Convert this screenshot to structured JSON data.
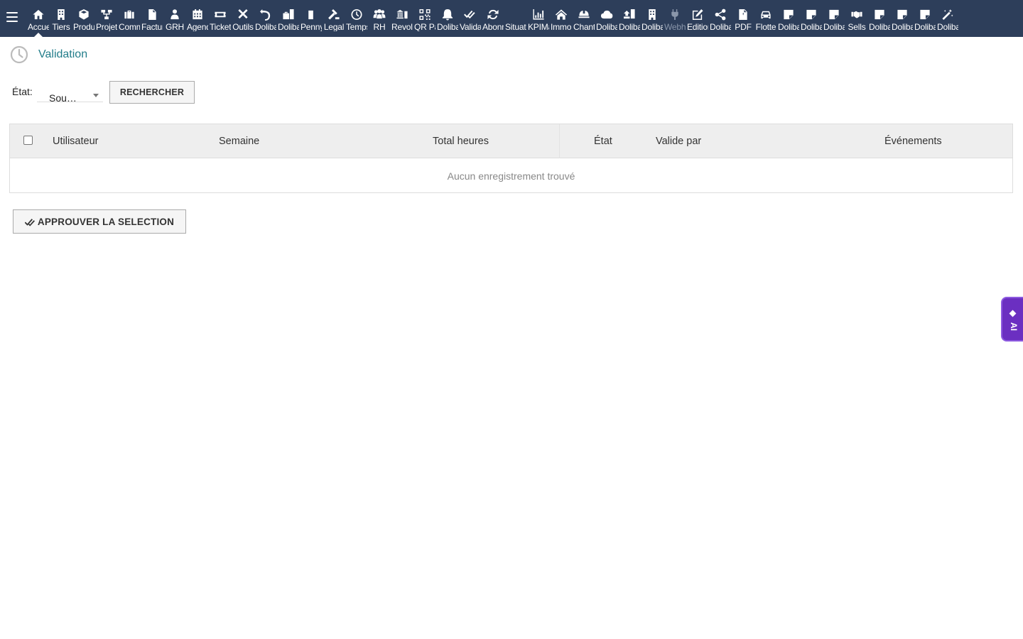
{
  "nav": {
    "items": [
      {
        "label": "Accueil",
        "icon": "home-icon",
        "active": true
      },
      {
        "label": "Tiers",
        "icon": "building-icon"
      },
      {
        "label": "Produits",
        "icon": "cube-icon"
      },
      {
        "label": "Projets",
        "icon": "project-icon"
      },
      {
        "label": "Commerce",
        "icon": "briefcase-icon"
      },
      {
        "label": "Facturation",
        "icon": "invoice-icon"
      },
      {
        "label": "GRH",
        "icon": "users-icon"
      },
      {
        "label": "Agenda",
        "icon": "calendar-icon"
      },
      {
        "label": "Tickets",
        "icon": "ticket-icon"
      },
      {
        "label": "Outils",
        "icon": "tools-icon"
      },
      {
        "label": "Dolibarr",
        "icon": "undo-icon"
      },
      {
        "label": "Dolibarr",
        "icon": "suitcase-icon"
      },
      {
        "label": "Penny",
        "icon": "note-icon"
      },
      {
        "label": "Legal",
        "icon": "gavel-icon"
      },
      {
        "label": "Temps",
        "icon": "clock-icon"
      },
      {
        "label": "RH",
        "icon": "group-icon"
      },
      {
        "label": "Revolut",
        "icon": "bank-icon"
      },
      {
        "label": "QR Pay",
        "icon": "qrcode-icon"
      },
      {
        "label": "Dolibarr",
        "icon": "bell-icon"
      },
      {
        "label": "Validation",
        "icon": "check-double-icon"
      },
      {
        "label": "Abonnements",
        "icon": "sync-icon"
      },
      {
        "label": "Situation",
        "icon": "blank-icon"
      },
      {
        "label": "KPIMax",
        "icon": "chart-bar-icon"
      },
      {
        "label": "Immobilier",
        "icon": "house-icon"
      },
      {
        "label": "Chantier",
        "icon": "helmet-icon"
      },
      {
        "label": "Dolibarr",
        "icon": "cloud-icon"
      },
      {
        "label": "Dolibarr",
        "icon": "upload-icon"
      },
      {
        "label": "Dolibarr",
        "icon": "building-icon"
      },
      {
        "label": "Webhook",
        "icon": "plug-icon",
        "dim": true
      },
      {
        "label": "Editions",
        "icon": "edit-icon"
      },
      {
        "label": "Dolibarr",
        "icon": "share-icon"
      },
      {
        "label": "PDF",
        "icon": "pdf-icon"
      },
      {
        "label": "Flotte",
        "icon": "car-icon"
      },
      {
        "label": "Dolibarr",
        "icon": "sticky-note-icon"
      },
      {
        "label": "Dolibarr",
        "icon": "sticky-note-icon"
      },
      {
        "label": "Dolibarr",
        "icon": "sticky-note-icon"
      },
      {
        "label": "Sells",
        "icon": "handshake-icon"
      },
      {
        "label": "Dolibarr",
        "icon": "sticky-note-icon"
      },
      {
        "label": "Dolibarr",
        "icon": "sticky-note-icon"
      },
      {
        "label": "Dolibarr",
        "icon": "sticky-note-icon"
      },
      {
        "label": "Dolibarr",
        "icon": "magic-icon"
      }
    ]
  },
  "page": {
    "title": "Validation"
  },
  "filter": {
    "label": "État:",
    "selected": "Sou…",
    "search_button": "RECHERCHER"
  },
  "table": {
    "headers": {
      "user": "Utilisateur",
      "week": "Semaine",
      "total_hours": "Total heures",
      "state": "État",
      "validated_by": "Valide par",
      "events": "Événements"
    },
    "empty_message": "Aucun enregistrement trouvé"
  },
  "actions": {
    "approve_label": "APPROUVER LA SELECTION"
  },
  "ai_tab": {
    "label": "AI"
  },
  "colors": {
    "navbar": "#2d3e5a",
    "title": "#227d8a",
    "ai_tab": "#6b2fc1"
  }
}
